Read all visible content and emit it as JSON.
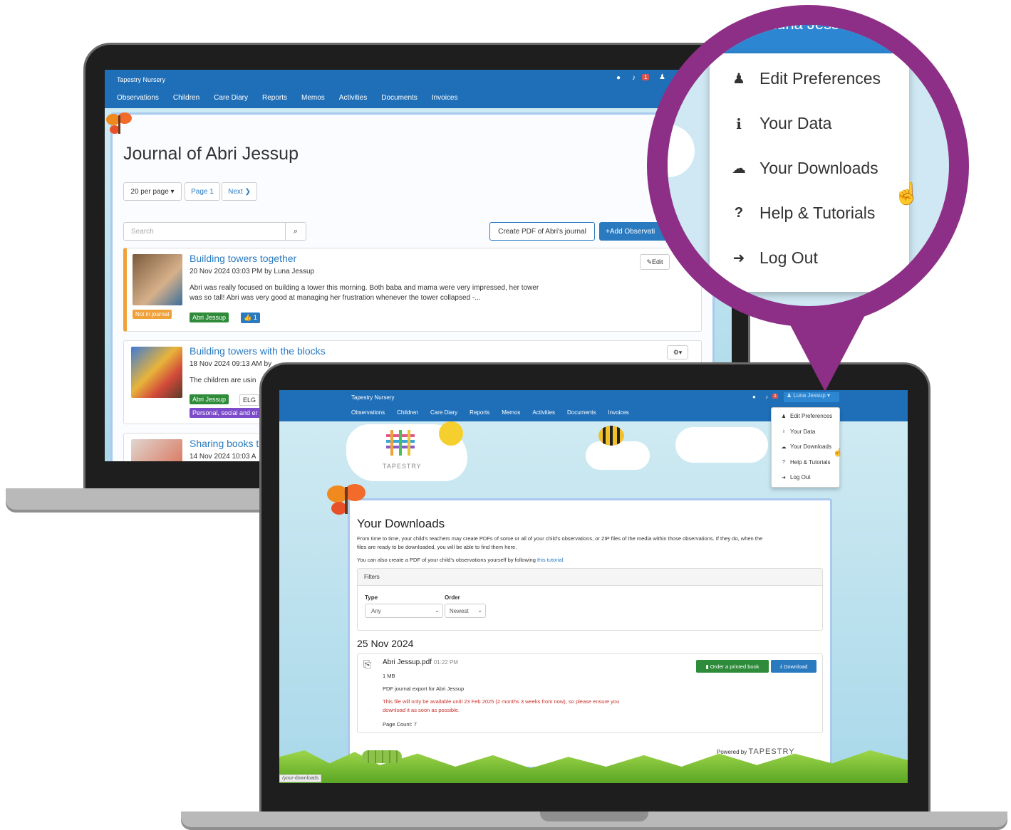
{
  "app": {
    "brand": "Tapestry Nursery"
  },
  "nav": [
    "Observations",
    "Children",
    "Care Diary",
    "Reports",
    "Memos",
    "Activities",
    "Documents",
    "Invoices"
  ],
  "user": {
    "name": "Luna Jessup",
    "name_zoom": "Luna Jess",
    "notifications": "1"
  },
  "user_menu": [
    "Edit Preferences",
    "Your Data",
    "Your Downloads",
    "Help & Tutorials",
    "Log Out"
  ],
  "journal": {
    "title": "Journal of Abri Jessup",
    "per_page": "20 per page",
    "page": "Page 1",
    "next": "Next",
    "search_placeholder": "Search",
    "create_pdf": "Create PDF of Abri's journal",
    "add_obs": "+Add Observati",
    "edit": "Edit",
    "observations": [
      {
        "title": "Building towers together",
        "meta": "20 Nov 2024 03:03 PM by Luna Jessup",
        "text1": "Abri was really focused on building a tower this morning. Both baba and mama were very impressed, her tower",
        "text2": "was so tall! Abri was very good at managing her frustration whenever the tower collapsed -...",
        "badge": "Not in journal",
        "child": "Abri Jessup",
        "likes": "1"
      },
      {
        "title": "Building towers with the blocks",
        "meta": "18 Nov 2024 09:13 AM by",
        "text1": "The children are usin",
        "child": "Abri Jessup",
        "tag2": "ELG",
        "area": "Personal, social and er"
      },
      {
        "title": "Sharing books t",
        "meta": "14 Nov 2024 10:03 A"
      }
    ]
  },
  "downloads": {
    "title": "Your Downloads",
    "intro1": "From time to time, your child's teachers may create PDFs of some or all of your child's observations, or ZIP files of the media within those observations. If they do, when the",
    "intro2": "files are ready to be downloaded, you will be able to find them here.",
    "intro3": "You can also create a PDF of your child's observations yourself by following",
    "tutorial_link": "this tutorial.",
    "filters": "Filters",
    "type_label": "Type",
    "type_value": "Any",
    "order_label": "Order",
    "order_value": "Newest",
    "date": "25 Nov 2024",
    "file_name": "Abri Jessup.pdf",
    "file_time": "01:22 PM",
    "file_size": "1 MB",
    "file_desc": "PDF journal export for Abri Jessup",
    "warn1": "This file will only be available until 23 Feb 2025 (2 months 3 weeks from now), so please ensure you",
    "warn2": "download it as soon as possible.",
    "page_count": "Page Count: 7",
    "order_book": "Order a printed book",
    "download": "Download",
    "powered": "Powered by",
    "logo": "TAPESTRY",
    "status_url": "/your-downloads"
  },
  "colors": {
    "nav": "#1f6fb8",
    "accent": "#8d2f86",
    "green": "#2e8b3a",
    "warning": "#c9302c"
  }
}
